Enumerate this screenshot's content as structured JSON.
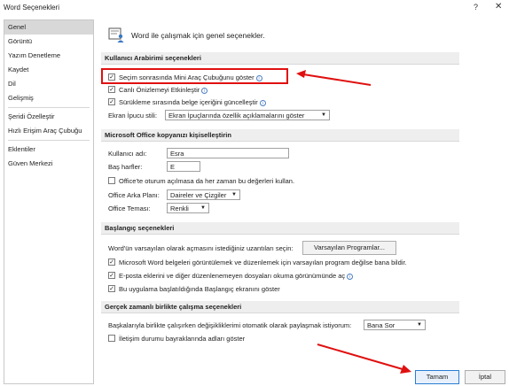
{
  "window": {
    "title": "Word Seçenekleri",
    "help": "?",
    "close": "✕"
  },
  "sidebar": {
    "items": [
      "Genel",
      "Görüntü",
      "Yazım Denetleme",
      "Kaydet",
      "Dil",
      "Gelişmiş",
      "Şeridi Özelleştir",
      "Hızlı Erişim Araç Çubuğu",
      "Eklentiler",
      "Güven Merkezi"
    ]
  },
  "intro": {
    "text": "Word ile çalışmak için genel seçenekler."
  },
  "ui_section": {
    "title": "Kullanıcı Arabirimi seçenekleri",
    "mini_toolbar": "Seçim sonrasında Mini Araç Çubuğunu göster",
    "live_preview": "Canlı Önizlemeyi Etkinleştir",
    "drag_update": "Sürükleme sırasında belge içeriğini güncelleştir",
    "tooltip_label": "Ekran İpucu stili:",
    "tooltip_value": "Ekran İpuçlarında özellik açıklamalarını göster"
  },
  "office_section": {
    "title": "Microsoft Office kopyanızı kişiselleştirin",
    "username_label": "Kullanıcı adı:",
    "username_value": "Esra",
    "initials_label": "Baş harfler:",
    "initials_value": "E",
    "always_use": "Office'te oturum açılmasa da her zaman bu değerleri kullan.",
    "background_label": "Office Arka Planı:",
    "background_value": "Daireler ve Çizgiler",
    "theme_label": "Office Teması:",
    "theme_value": "Renkli"
  },
  "startup_section": {
    "title": "Başlangıç seçenekleri",
    "default_ext": "Word'ün varsayılan olarak açmasını istediğiniz uzantıları seçin:",
    "default_programs_button": "Varsayılan Programlar...",
    "notify_default": "Microsoft Word belgeleri görüntülemek ve düzenlemek için varsayılan program değilse bana bildir.",
    "open_reading": "E-posta eklerini ve diğer düzenlenemeyen dosyaları okuma görünümünde aç",
    "show_start": "Bu uygulama başlatıldığında Başlangıç ekranını göster"
  },
  "realtime_section": {
    "title": "Gerçek zamanlı birlikte çalışma seçenekleri",
    "share_label": "Başkalarıyla birlikte çalışırken değişikliklerimi otomatik olarak paylaşmak istiyorum:",
    "share_value": "Bana Sor",
    "show_names": "İletişim durumu bayraklarında adları göster"
  },
  "footer": {
    "ok": "Tamam",
    "cancel": "İptal"
  },
  "colors": {
    "highlight": "#e01010",
    "accent": "#2a7ed2"
  }
}
